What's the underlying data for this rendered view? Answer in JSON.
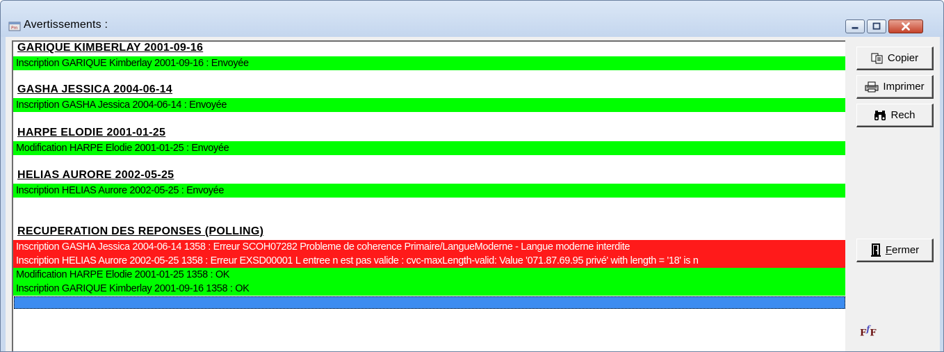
{
  "window": {
    "title": "Avertissements :",
    "icon": "app-window-icon",
    "controls": [
      "minimize-icon",
      "maximize-icon",
      "close-icon"
    ]
  },
  "log": {
    "entries": [
      {
        "heading": "GARIQUE KIMBERLAY 2001-09-16",
        "lines": [
          {
            "text": "Inscription GARIQUE Kimberlay 2001-09-16 : Envoyée",
            "status": "ok"
          }
        ]
      },
      {
        "heading": "GASHA JESSICA 2004-06-14",
        "lines": [
          {
            "text": "Inscription GASHA Jessica 2004-06-14 : Envoyée",
            "status": "ok"
          }
        ]
      },
      {
        "heading": "HARPE ELODIE 2001-01-25",
        "lines": [
          {
            "text": "Modification HARPE Elodie 2001-01-25 : Envoyée",
            "status": "ok"
          }
        ]
      },
      {
        "heading": "HELIAS AURORE 2002-05-25",
        "lines": [
          {
            "text": "Inscription HELIAS Aurore 2002-05-25 : Envoyée",
            "status": "ok"
          }
        ]
      },
      {
        "heading": "RECUPERATION DES REPONSES (POLLING)",
        "lines": [
          {
            "text": "Inscription GASHA Jessica 2004-06-14 1358 : Erreur SCOH07282 Probleme de coherence Primaire/LangueModerne - Langue moderne interdite",
            "status": "error"
          },
          {
            "text": "Inscription HELIAS Aurore 2002-05-25 1358 : Erreur EXSD00001 L entree n est pas valide : cvc-maxLength-valid: Value '071.87.69.95 privé' with length = '18' is n",
            "status": "error"
          },
          {
            "text": "Modification HARPE Elodie 2001-01-25 1358 : OK",
            "status": "ok"
          },
          {
            "text": "Inscription GARIQUE Kimberlay 2001-09-16 1358 : OK",
            "status": "ok"
          }
        ]
      }
    ]
  },
  "buttons": {
    "copy": {
      "label": "Copier",
      "icon": "copy-icon"
    },
    "print": {
      "label": "Imprimer",
      "icon": "printer-icon"
    },
    "search": {
      "label": "Rech",
      "icon": "binoculars-icon"
    },
    "close": {
      "label": "Fermer",
      "icon": "door-exit-icon"
    }
  },
  "logo": {
    "main": "F",
    "sup": "f",
    "tail": "F"
  },
  "colors": {
    "ok": "#00ff00",
    "error": "#ff1a1a",
    "selection": "#3c8cf0"
  }
}
